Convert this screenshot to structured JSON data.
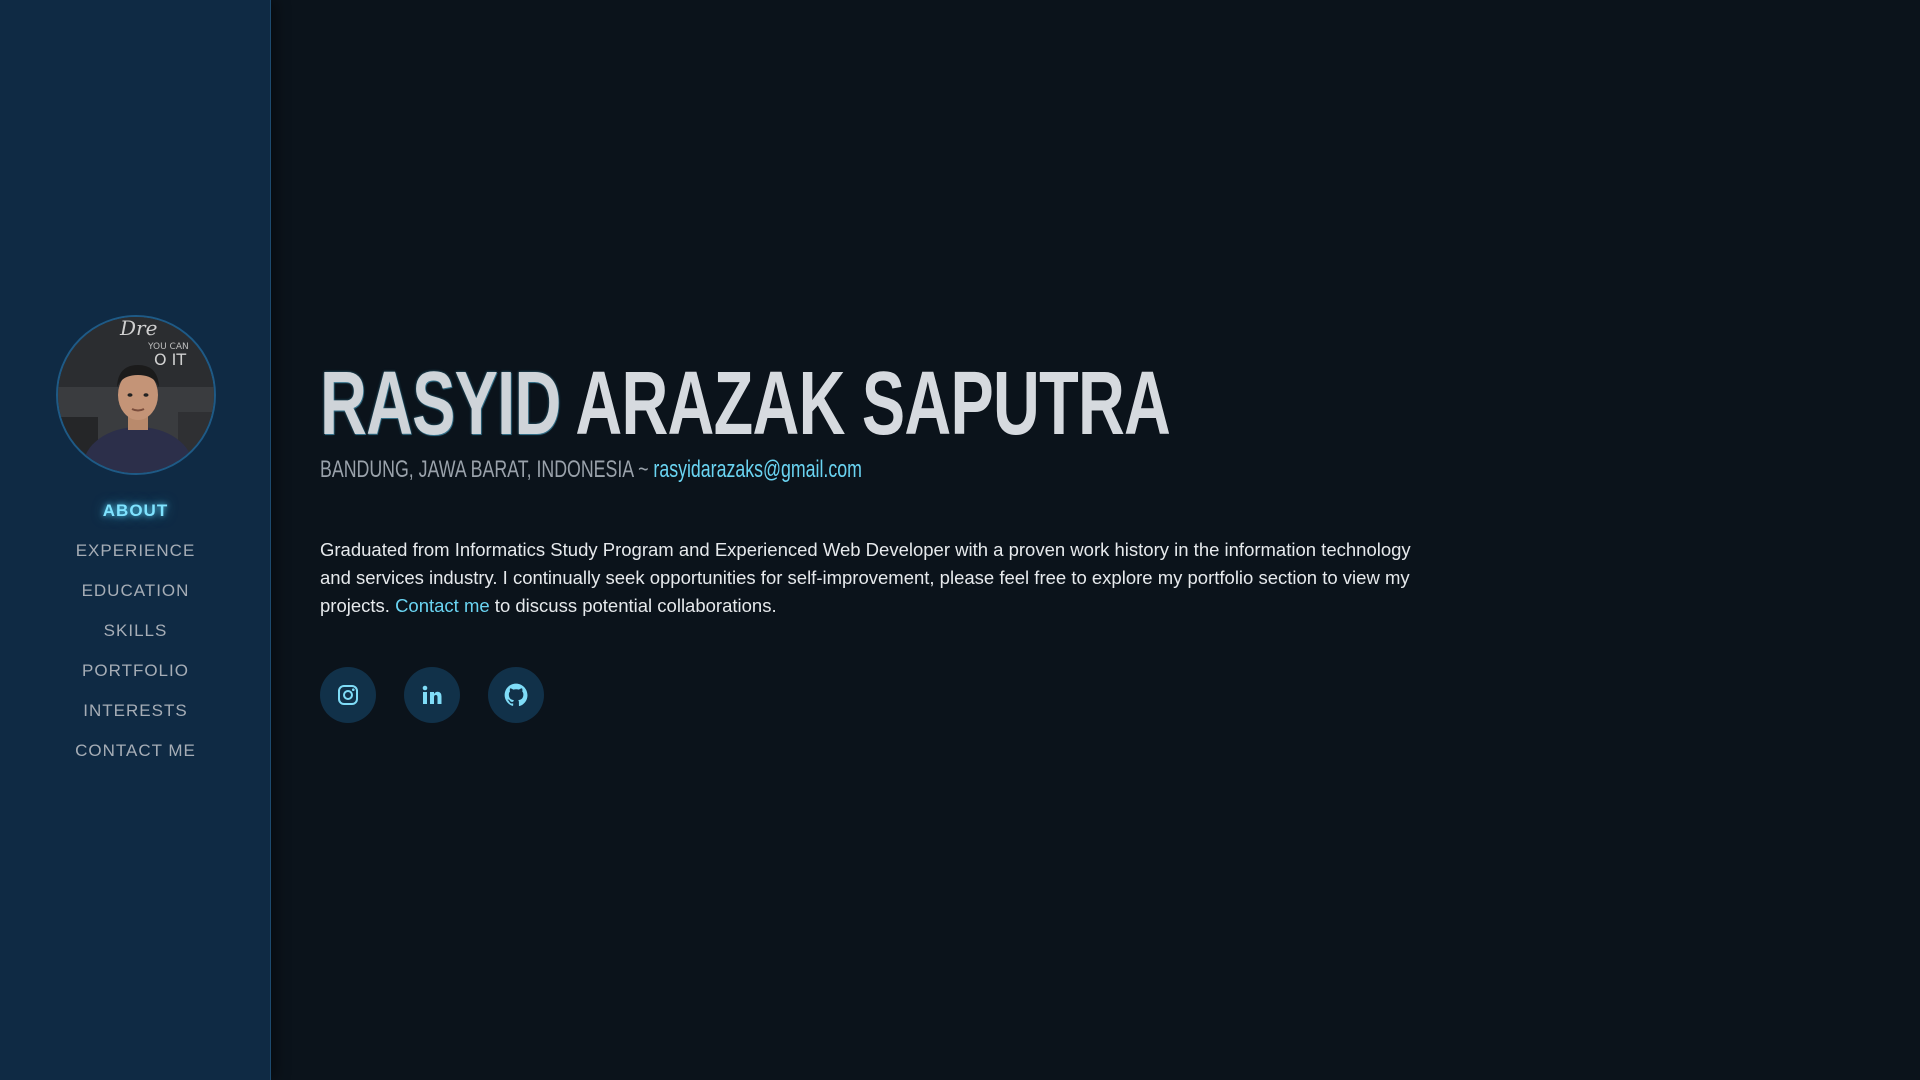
{
  "profile": {
    "photo_alt": "Profile photo"
  },
  "nav": {
    "items": [
      {
        "label": "ABOUT",
        "active": true
      },
      {
        "label": "EXPERIENCE",
        "active": false
      },
      {
        "label": "EDUCATION",
        "active": false
      },
      {
        "label": "SKILLS",
        "active": false
      },
      {
        "label": "PORTFOLIO",
        "active": false
      },
      {
        "label": "INTERESTS",
        "active": false
      },
      {
        "label": "CONTACT ME",
        "active": false
      }
    ]
  },
  "header": {
    "first_name": "RASYID",
    "rest_name": " ARAZAK SAPUTRA",
    "location": "BANDUNG, JAWA BARAT, INDONESIA ~ ",
    "email": "rasyidarazaks@gmail.com"
  },
  "about": {
    "text_main": "Graduated from Informatics Study Program and Experienced Web Developer with a proven work history in the information technology and services industry. I continually seek opportunities for self-improvement, please feel free to explore my portfolio section to view my projects. ",
    "contact_link": "Contact me",
    "text_tail": " to discuss potential collaborations."
  },
  "socials": [
    {
      "icon": "instagram-icon"
    },
    {
      "icon": "linkedin-icon"
    },
    {
      "icon": "github-icon"
    }
  ],
  "colors": {
    "accent": "#6ad4f2",
    "sidebar_bg": "#0f2a44",
    "page_bg": "#0b131b"
  }
}
